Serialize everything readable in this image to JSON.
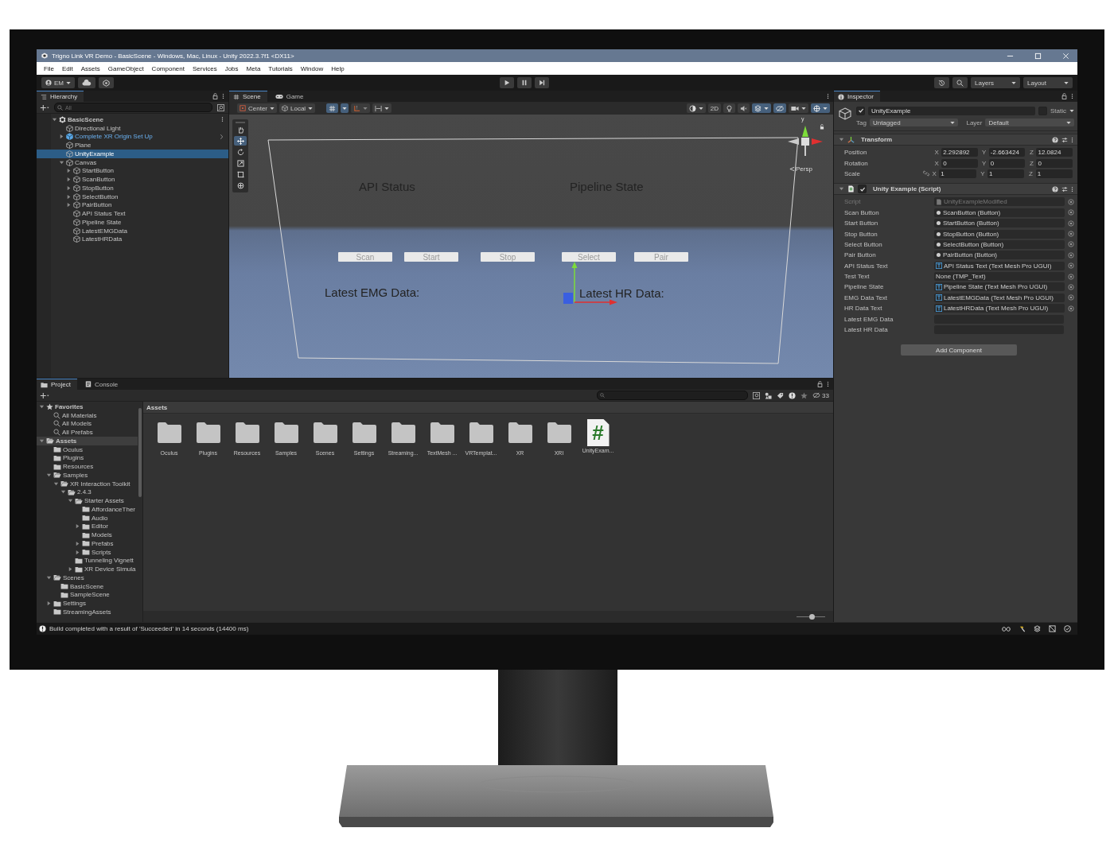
{
  "window": {
    "title": "Trigno Link VR Demo - BasicScene - Windows, Mac, Linux - Unity 2022.3.7f1 <DX11>"
  },
  "menu": [
    "File",
    "Edit",
    "Assets",
    "GameObject",
    "Component",
    "Services",
    "Jobs",
    "Meta",
    "Tutorials",
    "Window",
    "Help"
  ],
  "toolbar": {
    "account": "EM",
    "layers": "Layers",
    "layout": "Layout"
  },
  "hierarchy": {
    "title": "Hierarchy",
    "placeholder": "All",
    "items": [
      {
        "name": "BasicScene",
        "kind": "scene",
        "expanded": true,
        "selected": false,
        "children": [
          {
            "name": "Directional Light",
            "kind": "object",
            "selected": false
          },
          {
            "name": "Complete XR Origin Set Up",
            "kind": "prefab",
            "expanded": false,
            "selected": false
          },
          {
            "name": "Plane",
            "kind": "object",
            "selected": false
          },
          {
            "name": "UnityExample",
            "kind": "object",
            "selected": true
          },
          {
            "name": "Canvas",
            "kind": "object",
            "expanded": true,
            "selected": false,
            "children": [
              {
                "name": "StartButton",
                "kind": "object",
                "expanded": false,
                "selected": false
              },
              {
                "name": "ScanButton",
                "kind": "object",
                "expanded": false,
                "selected": false
              },
              {
                "name": "StopButton",
                "kind": "object",
                "expanded": false,
                "selected": false
              },
              {
                "name": "SelectButton",
                "kind": "object",
                "expanded": false,
                "selected": false
              },
              {
                "name": "PairButton",
                "kind": "object",
                "expanded": false,
                "selected": false
              },
              {
                "name": "API Status Text",
                "kind": "object",
                "selected": false
              },
              {
                "name": "Pipeline State",
                "kind": "object",
                "selected": false
              },
              {
                "name": "LatestEMGData",
                "kind": "object",
                "selected": false
              },
              {
                "name": "LatestHRData",
                "kind": "object",
                "selected": false
              }
            ]
          }
        ]
      }
    ]
  },
  "scene": {
    "tabs": [
      {
        "label": "Scene",
        "kind": "scene",
        "selected": true
      },
      {
        "label": "Game",
        "kind": "game",
        "selected": false
      }
    ],
    "pivot": "Center",
    "space": "Local",
    "mode_2d": "2D",
    "tools": [
      {
        "kind": "hand",
        "selected": false
      },
      {
        "kind": "move",
        "selected": true
      },
      {
        "kind": "rotate",
        "selected": false
      },
      {
        "kind": "scale",
        "selected": false
      },
      {
        "kind": "rect",
        "selected": false
      },
      {
        "kind": "transform",
        "selected": false
      }
    ],
    "axis_label": "y",
    "camera_label": "Persp",
    "canvas": {
      "api_status": "API Status",
      "pipeline_state": "Pipeline State",
      "buttons": [
        "Scan",
        "Start",
        "Stop",
        "Select",
        "Pair"
      ],
      "emg_label": "Latest EMG Data:",
      "hr_label": "Latest HR Data:"
    }
  },
  "inspector": {
    "title": "Inspector",
    "object": {
      "name": "UnityExample",
      "active": true,
      "static_label": "Static",
      "static": false,
      "tag_label": "Tag",
      "tag": "Untagged",
      "layer_label": "Layer",
      "layer": "Default"
    },
    "transform": {
      "title": "Transform",
      "rows": [
        {
          "label": "Position",
          "link_icon": false,
          "values": [
            {
              "axis": "X",
              "value": "2.292892"
            },
            {
              "axis": "Y",
              "value": "-2.663424"
            },
            {
              "axis": "Z",
              "value": "12.0824"
            }
          ]
        },
        {
          "label": "Rotation",
          "link_icon": false,
          "values": [
            {
              "axis": "X",
              "value": "0"
            },
            {
              "axis": "Y",
              "value": "0"
            },
            {
              "axis": "Z",
              "value": "0"
            }
          ]
        },
        {
          "label": "Scale",
          "link_icon": true,
          "values": [
            {
              "axis": "X",
              "value": "1"
            },
            {
              "axis": "Y",
              "value": "1"
            },
            {
              "axis": "Z",
              "value": "1"
            }
          ]
        }
      ]
    },
    "script": {
      "title": "Unity Example (Script)",
      "enabled": true,
      "fields": [
        {
          "label": "Script",
          "value": "UnityExampleModified",
          "kind": "script",
          "disabled": true
        },
        {
          "label": "Scan Button",
          "value": "ScanButton (Button)",
          "kind": "button",
          "disabled": false
        },
        {
          "label": "Start Button",
          "value": "StartButton (Button)",
          "kind": "button",
          "disabled": false
        },
        {
          "label": "Stop Button",
          "value": "StopButton (Button)",
          "kind": "button",
          "disabled": false
        },
        {
          "label": "Select Button",
          "value": "SelectButton (Button)",
          "kind": "button",
          "disabled": false
        },
        {
          "label": "Pair Button",
          "value": "PairButton (Button)",
          "kind": "button",
          "disabled": false
        },
        {
          "label": "API Status Text",
          "value": "API Status Text (Text Mesh Pro UGUI)",
          "kind": "text",
          "disabled": false
        },
        {
          "label": "Test Text",
          "value": "None (TMP_Text)",
          "kind": "none",
          "disabled": false
        },
        {
          "label": "Pipeline State",
          "value": "Pipeline State (Text Mesh Pro UGUI)",
          "kind": "text",
          "disabled": false
        },
        {
          "label": "EMG Data Text",
          "value": "LatestEMGData (Text Mesh Pro UGUI)",
          "kind": "text",
          "disabled": false
        },
        {
          "label": "HR Data Text",
          "value": "LatestHRData (Text Mesh Pro UGUI)",
          "kind": "text",
          "disabled": false
        },
        {
          "label": "Latest EMG Data",
          "kind": "string",
          "disabled": false
        },
        {
          "label": "Latest HR Data",
          "kind": "string",
          "disabled": false
        }
      ]
    },
    "add_component": "Add Component"
  },
  "project": {
    "tabs": [
      {
        "label": "Project",
        "kind": "project",
        "selected": true
      },
      {
        "label": "Console",
        "kind": "console",
        "selected": false
      }
    ],
    "tree": [
      {
        "name": "Favorites",
        "kind": "favorites",
        "expanded": true,
        "selected": false,
        "children": [
          {
            "name": "All Materials",
            "kind": "search",
            "selected": false
          },
          {
            "name": "All Models",
            "kind": "search",
            "selected": false
          },
          {
            "name": "All Prefabs",
            "kind": "search",
            "selected": false
          }
        ]
      },
      {
        "name": "Assets",
        "kind": "folder",
        "expanded": true,
        "selected": true,
        "children": [
          {
            "name": "Oculus",
            "kind": "folder",
            "selected": false
          },
          {
            "name": "Plugins",
            "kind": "folder",
            "selected": false
          },
          {
            "name": "Resources",
            "kind": "folder",
            "selected": false
          },
          {
            "name": "Samples",
            "kind": "folder",
            "expanded": true,
            "selected": false,
            "children": [
              {
                "name": "XR Interaction Toolkit",
                "kind": "folder",
                "expanded": true,
                "selected": false,
                "children": [
                  {
                    "name": "2.4.3",
                    "kind": "folder",
                    "expanded": true,
                    "selected": false,
                    "children": [
                      {
                        "name": "Starter Assets",
                        "kind": "folder",
                        "expanded": true,
                        "selected": false,
                        "children": [
                          {
                            "name": "AffordanceTher",
                            "kind": "folder",
                            "selected": false
                          },
                          {
                            "name": "Audio",
                            "kind": "folder",
                            "selected": false
                          },
                          {
                            "name": "Editor",
                            "kind": "folder",
                            "expanded": false,
                            "selected": false
                          },
                          {
                            "name": "Models",
                            "kind": "folder",
                            "selected": false
                          },
                          {
                            "name": "Prefabs",
                            "kind": "folder",
                            "expanded": false,
                            "selected": false
                          },
                          {
                            "name": "Scripts",
                            "kind": "folder",
                            "expanded": false,
                            "selected": false
                          }
                        ]
                      },
                      {
                        "name": "Tunneling Vignett",
                        "kind": "folder",
                        "selected": false
                      },
                      {
                        "name": "XR Device Simula",
                        "kind": "folder",
                        "expanded": false,
                        "selected": false
                      }
                    ]
                  }
                ]
              }
            ]
          },
          {
            "name": "Scenes",
            "kind": "folder",
            "expanded": true,
            "selected": false,
            "children": [
              {
                "name": "BasicScene",
                "kind": "folder",
                "selected": false
              },
              {
                "name": "SampleScene",
                "kind": "folder",
                "selected": false
              }
            ]
          },
          {
            "name": "Settings",
            "kind": "folder",
            "expanded": false,
            "selected": false
          },
          {
            "name": "StreamingAssets",
            "kind": "folder",
            "selected": false
          }
        ]
      }
    ],
    "breadcrumb": "Assets",
    "hidden_count": "33",
    "zoom": {
      "level": 0.55
    },
    "items": [
      {
        "name": "Oculus",
        "kind": "folder"
      },
      {
        "name": "Plugins",
        "kind": "folder"
      },
      {
        "name": "Resources",
        "kind": "folder"
      },
      {
        "name": "Samples",
        "kind": "folder"
      },
      {
        "name": "Scenes",
        "kind": "folder"
      },
      {
        "name": "Settings",
        "kind": "folder"
      },
      {
        "name": "Streaming...",
        "kind": "folder"
      },
      {
        "name": "TextMesh ...",
        "kind": "folder"
      },
      {
        "name": "VRTemplat...",
        "kind": "folder"
      },
      {
        "name": "XR",
        "kind": "folder"
      },
      {
        "name": "XRI",
        "kind": "folder"
      },
      {
        "name": "UnityExam...",
        "kind": "script",
        "glyph": "#"
      }
    ]
  },
  "status": {
    "message": "Build completed with a result of 'Succeeded' in 14 seconds (14400 ms)"
  }
}
